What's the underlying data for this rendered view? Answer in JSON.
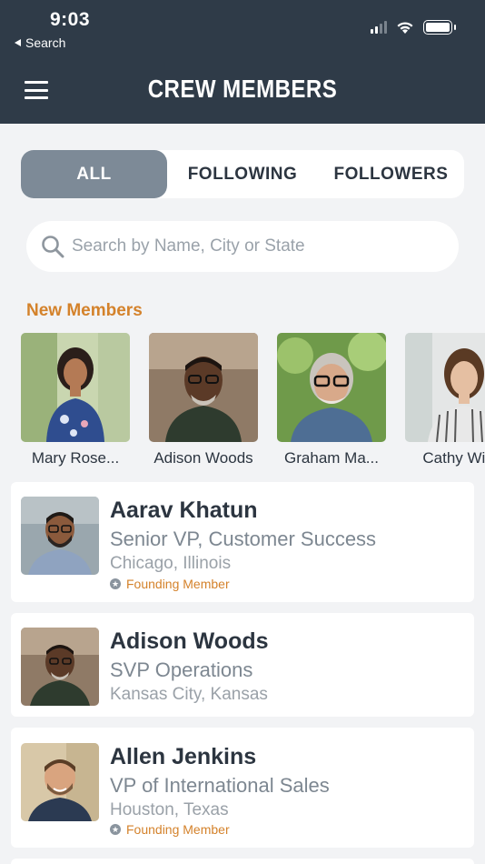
{
  "status_bar": {
    "time": "9:03",
    "back_label": "Search"
  },
  "header": {
    "title": "CREW MEMBERS"
  },
  "tabs": [
    {
      "label": "ALL",
      "selected": true
    },
    {
      "label": "FOLLOWING",
      "selected": false
    },
    {
      "label": "FOLLOWERS",
      "selected": false
    }
  ],
  "search": {
    "placeholder": "Search by Name, City or State",
    "value": ""
  },
  "new_members": {
    "title": "New Members",
    "items": [
      {
        "name": "Mary Rose..."
      },
      {
        "name": "Adison Woods"
      },
      {
        "name": "Graham Ma..."
      },
      {
        "name": "Cathy Wils"
      }
    ]
  },
  "members": [
    {
      "name": "Aarav Khatun",
      "role": "Senior VP, Customer Success",
      "location": "Chicago, Illinois",
      "badge": "Founding Member"
    },
    {
      "name": "Adison Woods",
      "role": "SVP Operations",
      "location": "Kansas City, Kansas",
      "badge": ""
    },
    {
      "name": "Allen Jenkins",
      "role": "VP of International Sales",
      "location": "Houston, Texas",
      "badge": "Founding Member"
    }
  ],
  "colors": {
    "header_bg": "#2f3b48",
    "accent": "#d4822b",
    "tab_selected": "#7d8a97"
  }
}
